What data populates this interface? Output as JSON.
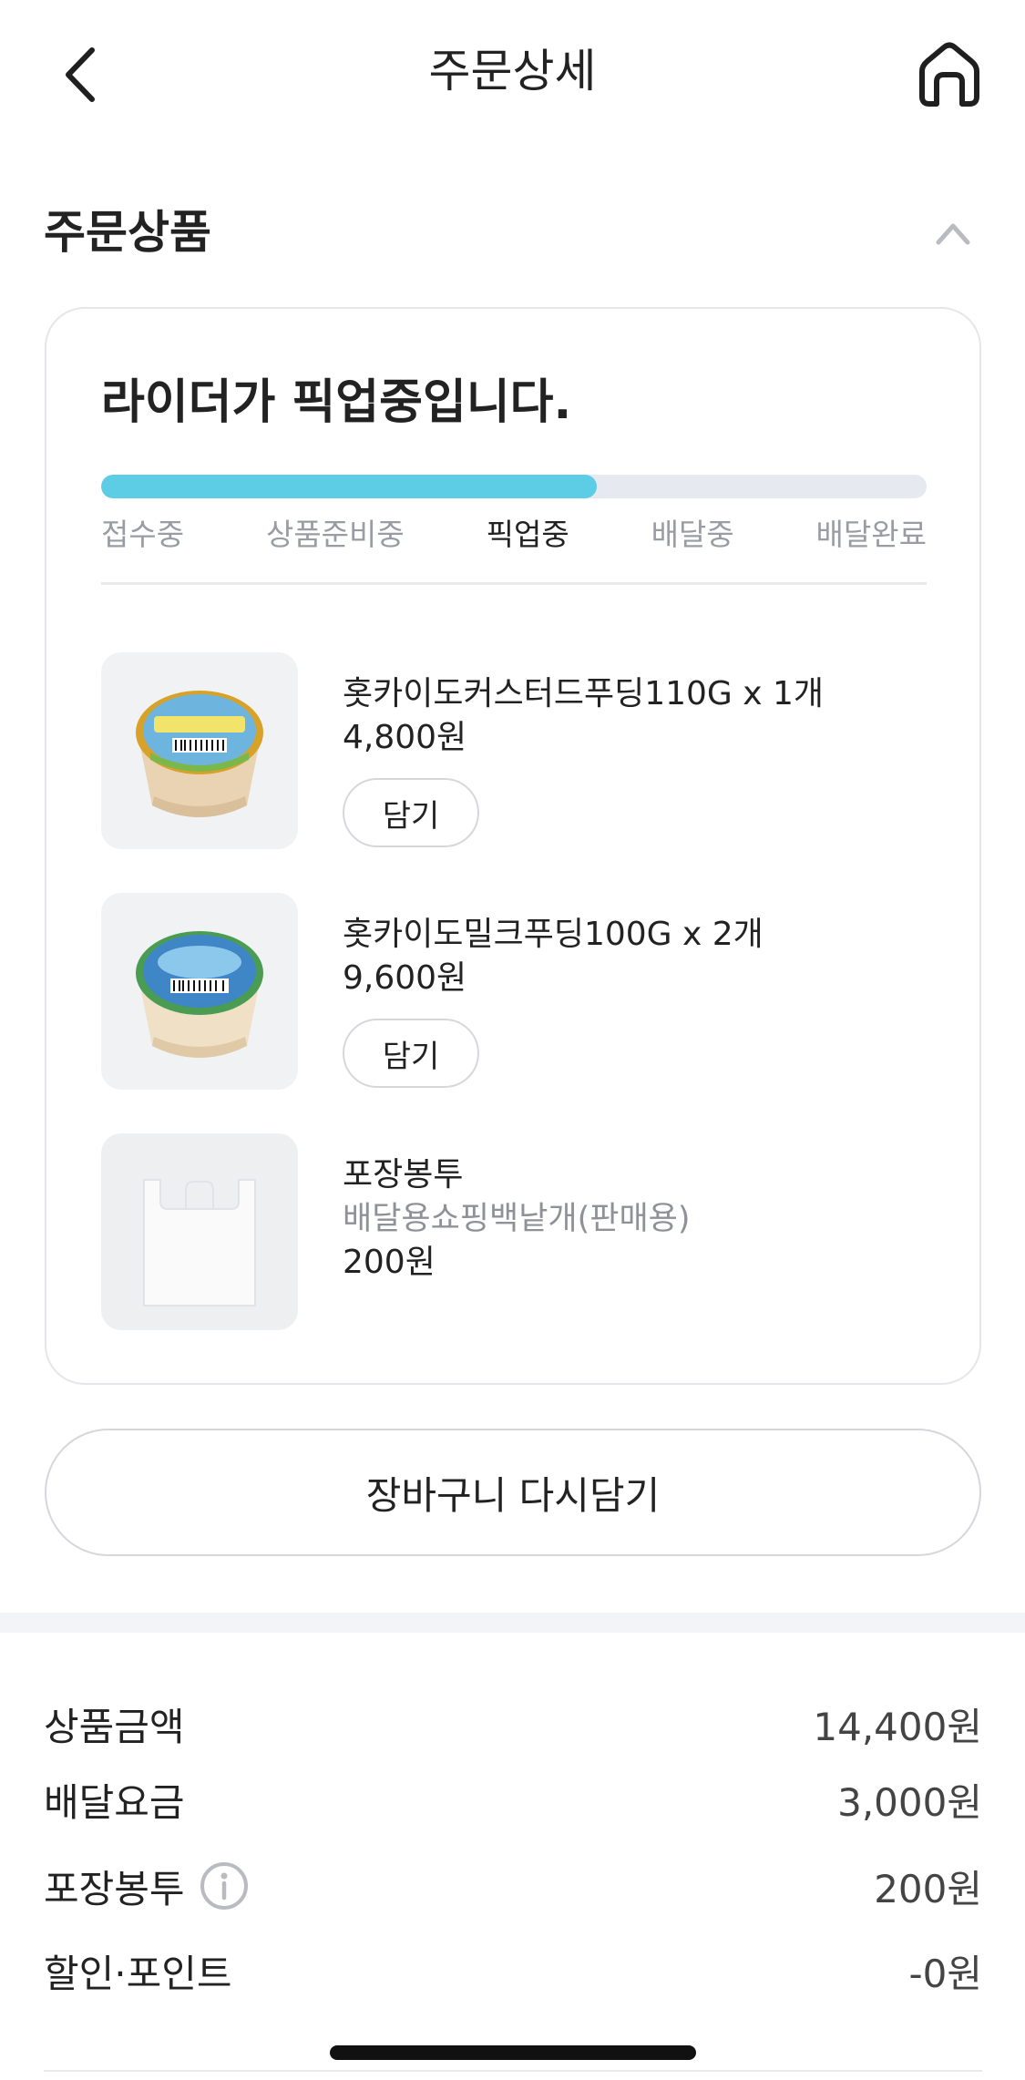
{
  "nav": {
    "title": "주문상세",
    "back_icon": "chevron-left-icon",
    "home_icon": "home-icon"
  },
  "section": {
    "title": "주문상품",
    "toggle_icon": "chevron-up-icon"
  },
  "order_status": {
    "message": "라이더가 픽업중입니다.",
    "progress_percent": 60,
    "progress_color": "#5ccde4",
    "steps": [
      "접수중",
      "상품준비중",
      "픽업중",
      "배달중",
      "배달완료"
    ],
    "active_step": 2
  },
  "items": [
    {
      "name": "홋카이도커스터드푸딩110G x 1개",
      "price": "4,800원",
      "add_label": "담기",
      "image": "custard-pudding-image"
    },
    {
      "name": "홋카이도밀크푸딩100G x 2개",
      "price": "9,600원",
      "add_label": "담기",
      "image": "milk-pudding-image"
    },
    {
      "name": "포장봉투",
      "subtitle": "배달용쇼핑백낱개(판매용)",
      "price": "200원",
      "image": "shopping-bag-image"
    }
  ],
  "reorder_label": "장바구니 다시담기",
  "summary": [
    {
      "label": "상품금액",
      "value": "14,400원"
    },
    {
      "label": "배달요금",
      "value": "3,000원"
    },
    {
      "label": "포장봉투",
      "value": "200원",
      "icon": "info-icon"
    },
    {
      "label": "할인·포인트",
      "value": "-0원"
    }
  ]
}
